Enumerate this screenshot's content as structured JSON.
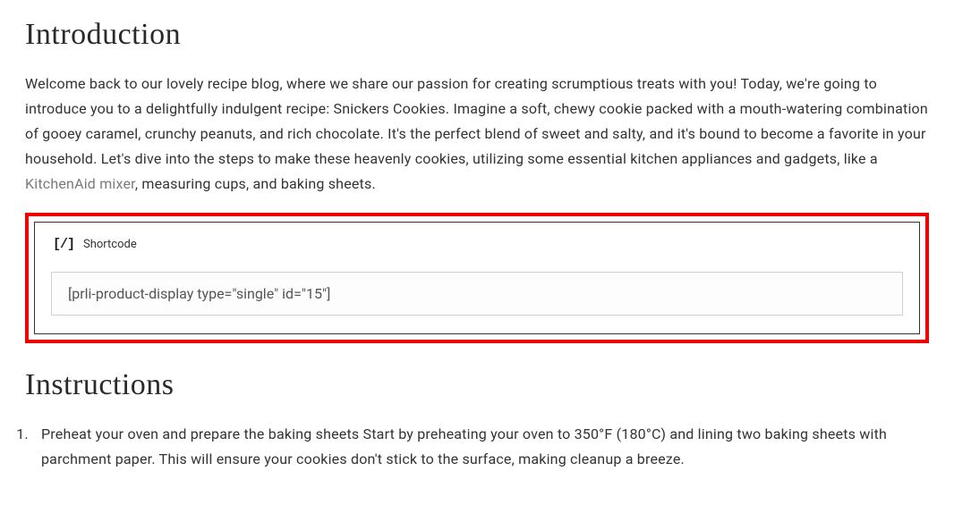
{
  "intro": {
    "heading": "Introduction",
    "text_before_link": "Welcome back to our lovely recipe blog, where we share our passion for creating scrumptious treats with you! Today, we're going to introduce you to a delightfully indulgent recipe: Snickers Cookies. Imagine a soft, chewy cookie packed with a mouth-watering combination of gooey caramel, crunchy peanuts, and rich chocolate. It's the perfect blend of sweet and salty, and it's bound to become a favorite in your household. Let's dive into the steps to make these heavenly cookies, utilizing some essential kitchen appliances and gadgets, like a ",
    "link_text": "KitchenAid mixer",
    "text_after_link": ", measuring cups, and baking sheets."
  },
  "shortcode": {
    "icon_text": "[/]",
    "label": "Shortcode",
    "value": "[prli-product-display type=\"single\" id=\"15\"]"
  },
  "instructions": {
    "heading": "Instructions",
    "step1": "Preheat your oven and prepare the baking sheets Start by preheating your oven to 350°F (180°C) and lining two baking sheets with parchment paper. This will ensure your cookies don't stick to the surface, making cleanup a breeze."
  }
}
